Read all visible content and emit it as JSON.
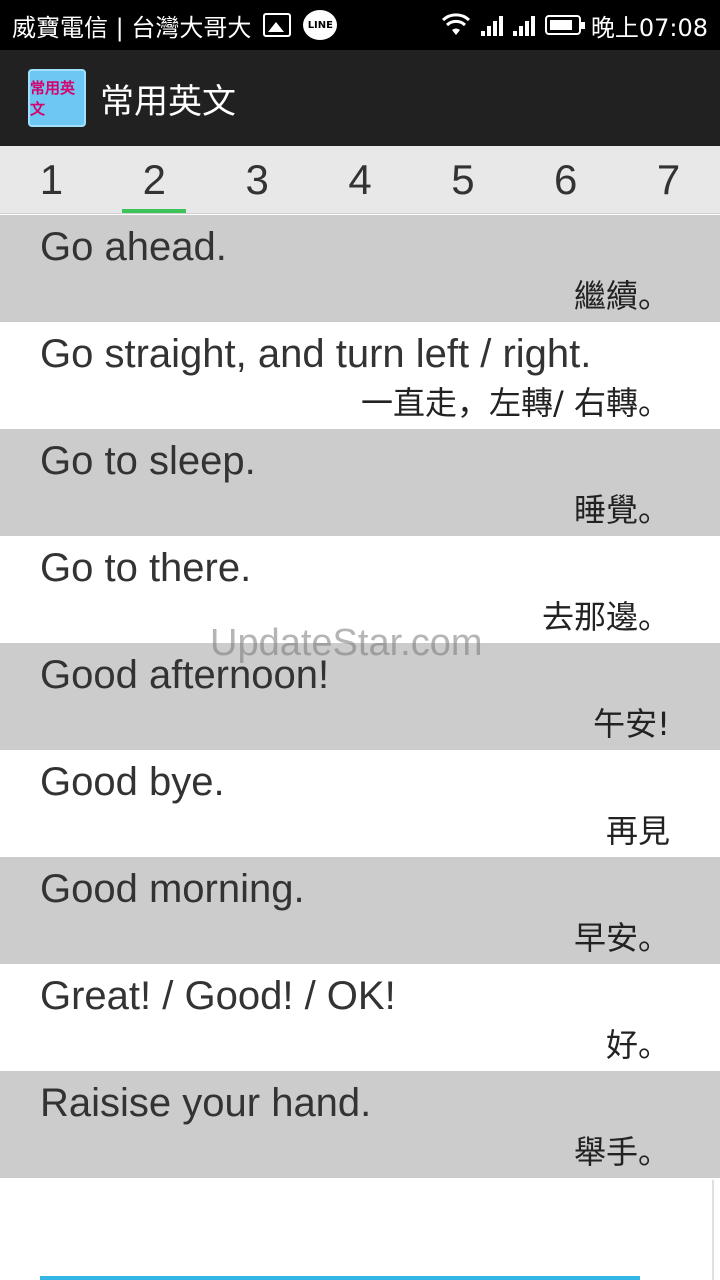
{
  "status_bar": {
    "carrier": "威寶電信 | 台灣大哥大",
    "line_label": "LINE",
    "time": "晚上07:08",
    "icons": [
      "photo-icon",
      "line-icon",
      "wifi-icon",
      "signal-icon",
      "signal-icon",
      "battery-icon"
    ]
  },
  "app_bar": {
    "logo_text": "常用英文",
    "title": "常用英文"
  },
  "tabs": [
    {
      "label": "1"
    },
    {
      "label": "2"
    },
    {
      "label": "3"
    },
    {
      "label": "4"
    },
    {
      "label": "5"
    },
    {
      "label": "6"
    },
    {
      "label": "7"
    }
  ],
  "active_tab": "2",
  "phrases": [
    {
      "en": "Go ahead.",
      "zh": "繼續。"
    },
    {
      "en": "Go straight, and turn left / right.",
      "zh": "一直走，左轉/ 右轉。"
    },
    {
      "en": "Go to sleep.",
      "zh": "睡覺。"
    },
    {
      "en": "Go to there.",
      "zh": "去那邊。"
    },
    {
      "en": "Good afternoon!",
      "zh": "午安!"
    },
    {
      "en": "Good bye.",
      "zh": "再見"
    },
    {
      "en": "Good morning.",
      "zh": "早安。"
    },
    {
      "en": "Great! / Good! / OK!",
      "zh": "好。"
    },
    {
      "en": "Raisise your hand.",
      "zh": "舉手。"
    }
  ],
  "watermark": "UpdateStar.com",
  "colors": {
    "status_bar_bg": "#000000",
    "app_bar_bg": "#212121",
    "tab_bar_bg": "#e8e8e8",
    "tab_indicator": "#3cc45a",
    "row_alt_bg": "#cccccc",
    "scroll_indicator": "#33b5e5"
  }
}
